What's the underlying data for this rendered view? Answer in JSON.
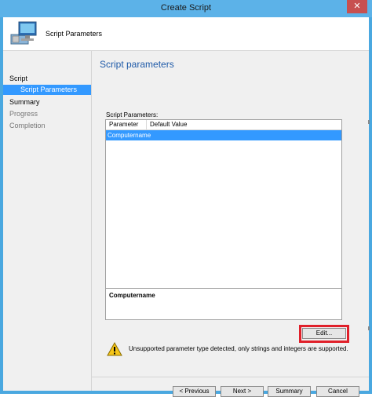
{
  "window": {
    "title": "Create Script",
    "close_glyph": "✕"
  },
  "header": {
    "title": "Script Parameters",
    "icon": "computer-icon"
  },
  "nav": {
    "items": [
      {
        "label": "Script",
        "state": "normal"
      },
      {
        "label": "Script Parameters",
        "state": "selected"
      },
      {
        "label": "Summary",
        "state": "normal"
      },
      {
        "label": "Progress",
        "state": "disabled"
      },
      {
        "label": "Completion",
        "state": "disabled"
      }
    ]
  },
  "main": {
    "title": "Script parameters",
    "group_label": "Script Parameters:",
    "table": {
      "columns": [
        "Parameter",
        "Default Value"
      ],
      "rows": [
        {
          "parameter": "Computername",
          "default_value": ""
        }
      ]
    },
    "description": "Computername",
    "edit_label": "Edit...",
    "warning_text": "Unsupported parameter type detected, only strings and integers are supported."
  },
  "footer": {
    "previous_label": "< Previous",
    "next_label": "Next >",
    "summary_label": "Summary",
    "cancel_label": "Cancel"
  },
  "colors": {
    "title_bar": "#5cb2e8",
    "selection": "#3399ff",
    "accent_title": "#1e5aa8",
    "highlight_box": "#e0202a",
    "close_button": "#c75050"
  }
}
